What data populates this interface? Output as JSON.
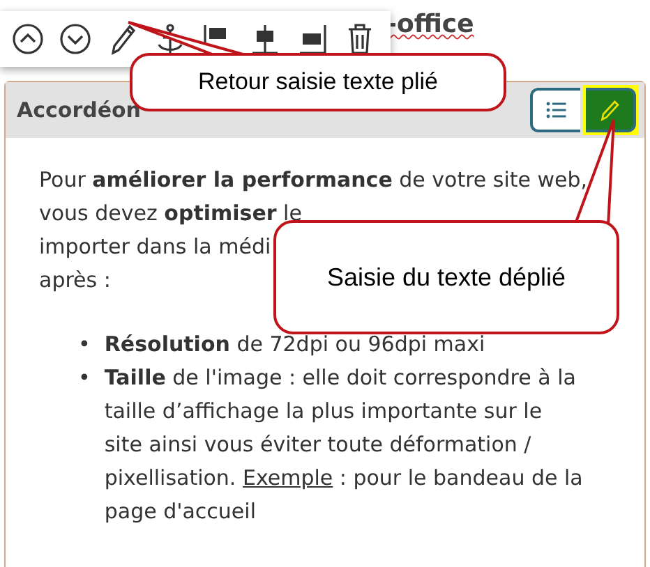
{
  "page_title": "-office",
  "callouts": [
    {
      "text": "Retour saisie texte plié"
    },
    {
      "text": "Saisie du texte déplié"
    }
  ],
  "accordion": {
    "title": "Accordéon",
    "view_buttons": [
      {
        "kind": "list",
        "selected": false,
        "highlighted": false
      },
      {
        "kind": "edit",
        "selected": true,
        "highlighted": true
      }
    ],
    "paragraph_lines": [
      "Pour **améliorer la performance** de votre site web,",
      "vous devez **optimiser** le",
      "importer dans la médi",
      "après :"
    ],
    "bullets": [
      {
        "marker": "•",
        "text": "**Résolution** de 72dpi ou 96dpi maxi"
      },
      {
        "marker": "•",
        "text": "**Taille**  de l'image : elle doit correspondre à la taille d’affichage la plus importante sur le site ainsi vous éviter toute déformation / pixellisation.",
        "link": "Exemple",
        "after": " : pour le bandeau de la page d'accueil"
      }
    ]
  }
}
